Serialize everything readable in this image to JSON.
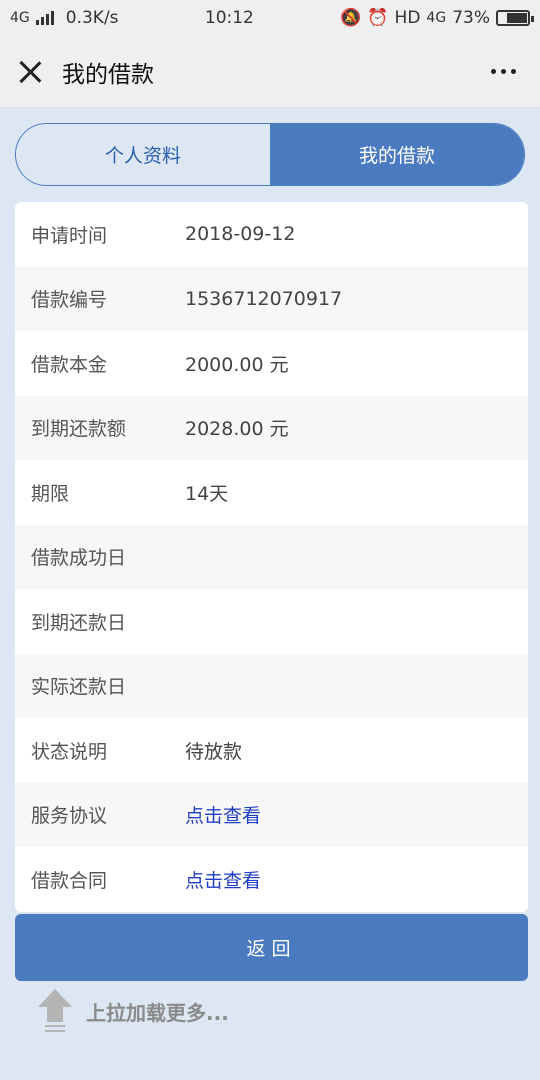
{
  "status_bar": {
    "network": "4G",
    "speed": "0.3K/s",
    "time": "10:12",
    "hd": "HD",
    "net2": "4G",
    "battery": "73%",
    "battery_level": 0.73
  },
  "header": {
    "title": "我的借款"
  },
  "tabs": [
    {
      "label": "个人资料",
      "active": false
    },
    {
      "label": "我的借款",
      "active": true
    }
  ],
  "details": [
    {
      "label": "申请时间",
      "value": "2018-09-12"
    },
    {
      "label": "借款编号",
      "value": "1536712070917"
    },
    {
      "label": "借款本金",
      "value": "2000.00 元"
    },
    {
      "label": "到期还款额",
      "value": "2028.00 元"
    },
    {
      "label": "期限",
      "value": "14天"
    },
    {
      "label": "借款成功日",
      "value": ""
    },
    {
      "label": "到期还款日",
      "value": ""
    },
    {
      "label": "实际还款日",
      "value": ""
    },
    {
      "label": "状态说明",
      "value": "待放款"
    },
    {
      "label": "服务协议",
      "value": "点击查看"
    },
    {
      "label": "借款合同",
      "value": "点击查看"
    }
  ],
  "back_button": "返回",
  "pull_up": "上拉加载更多...",
  "colors": {
    "accent": "#4a7abf",
    "background": "#dce7f3",
    "link": "#1f3fc2"
  }
}
